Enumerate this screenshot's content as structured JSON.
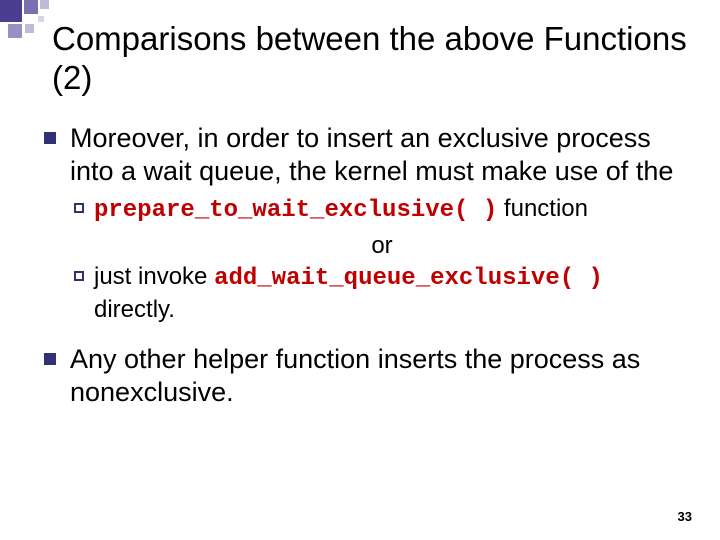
{
  "title": "Comparisons between the above Functions (2)",
  "body": {
    "p1": "Moreover, in order to insert an exclusive process into a wait queue, the kernel must make use of the",
    "fn1": "prepare_to_wait_exclusive( )",
    "fn1_suffix": " function",
    "or": "or",
    "p2_pre": "just invoke ",
    "fn2": "add_wait_queue_exclusive( )",
    "p2_post": " directly.",
    "p3": "Any other helper function inserts the process as nonexclusive."
  },
  "page_number": "33"
}
